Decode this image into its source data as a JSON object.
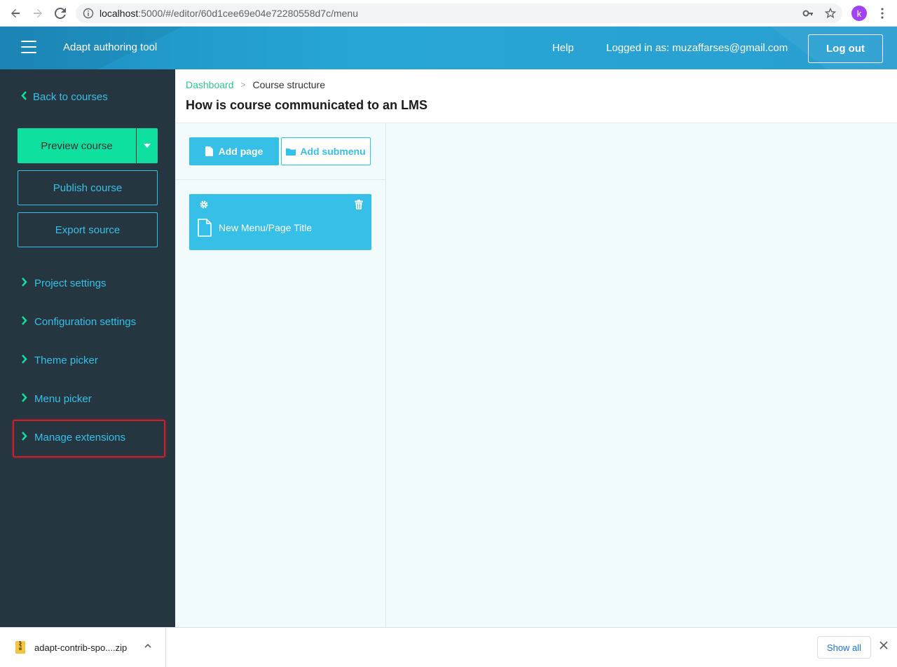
{
  "browser": {
    "url_host": "localhost",
    "url_rest": ":5000/#/editor/60d1cee69e04e72280558d7c/menu",
    "avatar_letter": "k"
  },
  "header": {
    "app_title": "Adapt authoring tool",
    "help_label": "Help",
    "logged_in_text": "Logged in as: muzaffarses@gmail.com",
    "logout_label": "Log out"
  },
  "sidebar": {
    "back_label": "Back to courses",
    "preview_label": "Preview course",
    "publish_label": "Publish course",
    "export_label": "Export source",
    "items": [
      {
        "label": "Project settings"
      },
      {
        "label": "Configuration settings"
      },
      {
        "label": "Theme picker"
      },
      {
        "label": "Menu picker"
      },
      {
        "label": "Manage extensions"
      }
    ]
  },
  "main": {
    "breadcrumb": {
      "dashboard": "Dashboard",
      "separator": ">",
      "current": "Course structure"
    },
    "title": "How is course communicated to an LMS",
    "add_page_label": "Add page",
    "add_submenu_label": "Add submenu",
    "page_card_title": "New Menu/Page Title"
  },
  "downloads": {
    "file_name": "adapt-contrib-spo....zip",
    "show_all_label": "Show all"
  },
  "colors": {
    "header_blue": "#27a6d6",
    "sidebar_bg": "#263641",
    "accent_green": "#0ee0a0",
    "accent_cyan": "#36c0e8",
    "highlight_red": "#d01f2a"
  }
}
